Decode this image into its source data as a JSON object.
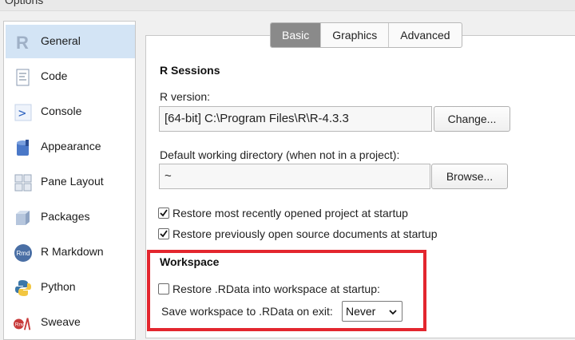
{
  "window": {
    "title": "Options"
  },
  "sidebar": {
    "items": [
      {
        "label": "General",
        "icon": "r-logo-icon",
        "active": true
      },
      {
        "label": "Code",
        "icon": "code-document-icon",
        "active": false
      },
      {
        "label": "Console",
        "icon": "console-prompt-icon",
        "active": false
      },
      {
        "label": "Appearance",
        "icon": "appearance-paint-icon",
        "active": false
      },
      {
        "label": "Pane Layout",
        "icon": "pane-layout-icon",
        "active": false
      },
      {
        "label": "Packages",
        "icon": "packages-box-icon",
        "active": false
      },
      {
        "label": "R Markdown",
        "icon": "rmarkdown-icon",
        "active": false
      },
      {
        "label": "Python",
        "icon": "python-logo-icon",
        "active": false
      },
      {
        "label": "Sweave",
        "icon": "sweave-pdf-icon",
        "active": false
      }
    ]
  },
  "tabs": [
    {
      "label": "Basic",
      "active": true
    },
    {
      "label": "Graphics",
      "active": false
    },
    {
      "label": "Advanced",
      "active": false
    }
  ],
  "r_sessions": {
    "title": "R Sessions",
    "r_version_label": "R version:",
    "r_version_value": "[64-bit] C:\\Program Files\\R\\R-4.3.3",
    "change_button": "Change...",
    "working_dir_label": "Default working directory (when not in a project):",
    "working_dir_value": "~",
    "browse_button": "Browse...",
    "restore_project_label": "Restore most recently opened project at startup",
    "restore_project_checked": true,
    "restore_docs_label": "Restore previously open source documents at startup",
    "restore_docs_checked": true
  },
  "workspace": {
    "title": "Workspace",
    "restore_rdata_label": "Restore .RData into workspace at startup:",
    "restore_rdata_checked": false,
    "save_label": "Save workspace to .RData on exit:",
    "save_value": "Never"
  },
  "colors": {
    "highlight_border": "#e3262e",
    "sidebar_active": "#d3e4f5",
    "tab_active": "#8a8a8a"
  }
}
